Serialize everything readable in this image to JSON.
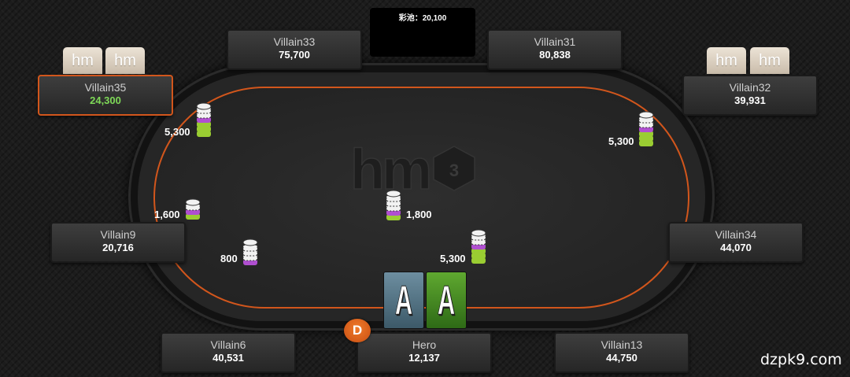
{
  "pot": {
    "label": "彩池：20,100"
  },
  "table": {
    "logo_text": "hm",
    "logo_version": "3"
  },
  "hud_badge_text": "hm",
  "seats": [
    {
      "id": "villain33",
      "name": "Villain33",
      "stack": "75,700"
    },
    {
      "id": "villain31",
      "name": "Villain31",
      "stack": "80,838"
    },
    {
      "id": "villain35",
      "name": "Villain35",
      "stack": "24,300",
      "active": true
    },
    {
      "id": "villain32",
      "name": "Villain32",
      "stack": "39,931"
    },
    {
      "id": "villain9",
      "name": "Villain9",
      "stack": "20,716"
    },
    {
      "id": "villain34",
      "name": "Villain34",
      "stack": "44,070"
    },
    {
      "id": "villain6",
      "name": "Villain6",
      "stack": "40,531"
    },
    {
      "id": "hero",
      "name": "Hero",
      "stack": "12,137"
    },
    {
      "id": "villain13",
      "name": "Villain13",
      "stack": "44,750"
    }
  ],
  "bets": {
    "villain35": "5,300",
    "villain32": "5,300",
    "villain9": "1,600",
    "center": "1,800",
    "villain6": "800",
    "hero": "5,300"
  },
  "chip_colors": {
    "green": "#9acd32",
    "purple": "#b04fd0",
    "white": "#f2f2f2"
  },
  "hero_cards": [
    {
      "rank": "A",
      "color": "#4f6f80"
    },
    {
      "rank": "A",
      "color": "#4a8f26"
    }
  ],
  "dealer_button": "D",
  "watermark": "dzpk9.com",
  "colors": {
    "accent": "#d2561c",
    "active_stack": "#7ed957"
  }
}
